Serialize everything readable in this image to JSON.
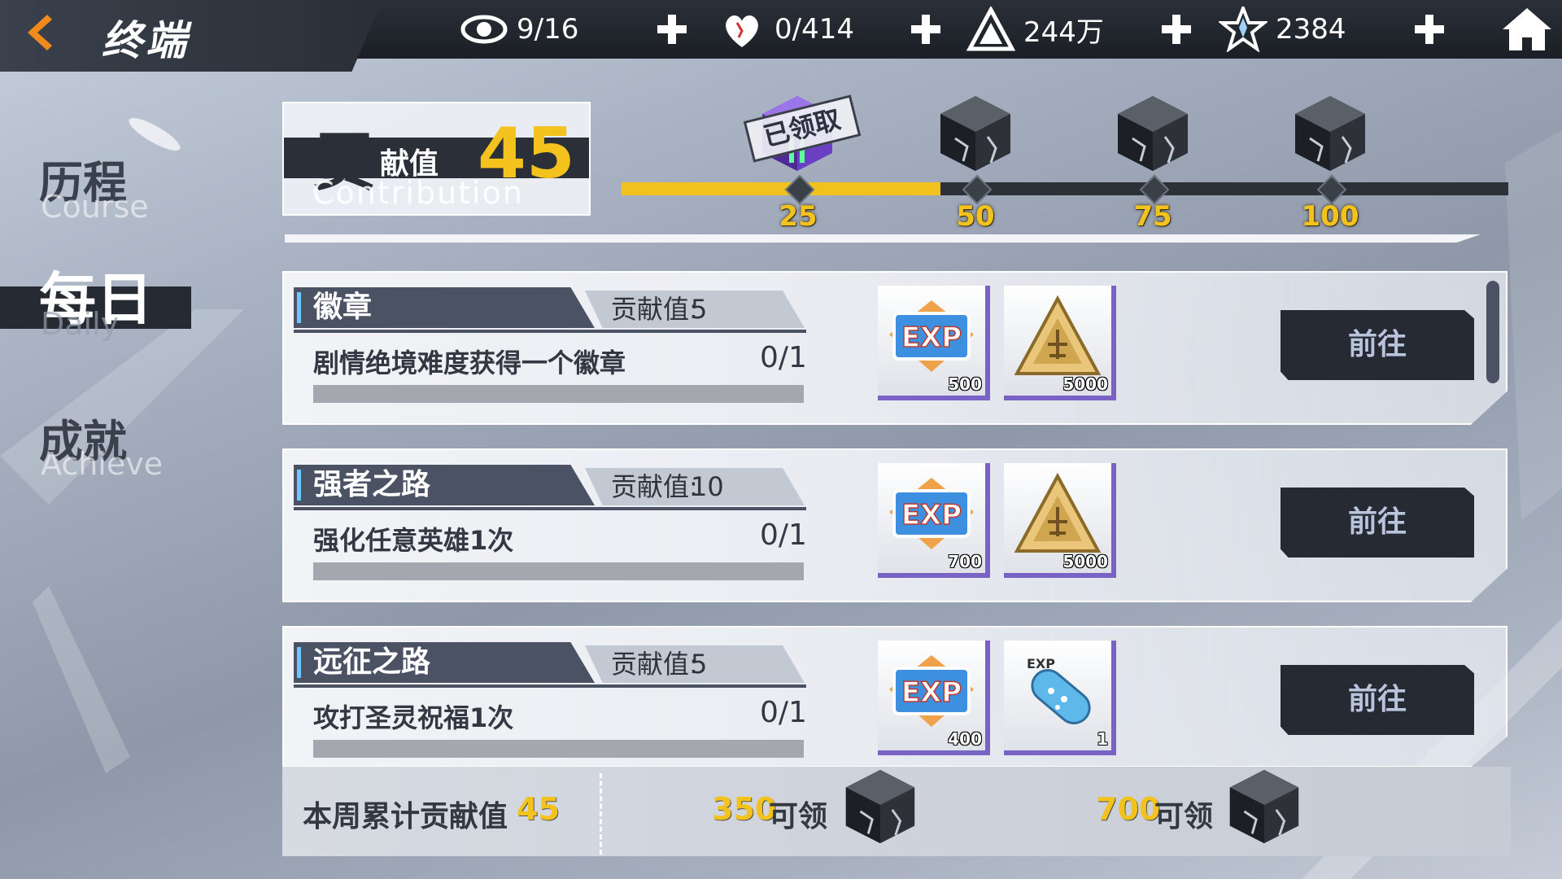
{
  "topbar": {
    "title": "终端",
    "resources": [
      {
        "name": "stamina",
        "icon": "eye-icon",
        "value": "9/16"
      },
      {
        "name": "heart",
        "icon": "heart-icon",
        "value": "0/414"
      },
      {
        "name": "gold",
        "icon": "triangle-coin-icon",
        "value": "244万"
      },
      {
        "name": "crystal",
        "icon": "star-crystal-icon",
        "value": "2384"
      }
    ]
  },
  "sidebar": {
    "items": [
      {
        "cn": "历程",
        "en": "Course",
        "active": false
      },
      {
        "cn": "每日",
        "en": "Daily",
        "active": true
      },
      {
        "cn": "成就",
        "en": "Achieve",
        "active": false
      }
    ]
  },
  "contribution": {
    "big_char": "贡",
    "small_text": "献值",
    "value": "45",
    "en": "Contribution",
    "progress": 0.45,
    "claimed_stamp": "已领取",
    "milestones": [
      "25",
      "50",
      "75",
      "100"
    ]
  },
  "tasks": [
    {
      "name": "徽章",
      "points_label": "贡献值:",
      "points": "5",
      "desc": "剧情绝境难度获得一个徽章",
      "progress": "0/1",
      "rewards": [
        {
          "icon": "exp-icon",
          "count": "500"
        },
        {
          "icon": "gold-coin-icon",
          "count": "5000"
        }
      ],
      "button": "前往"
    },
    {
      "name": "强者之路",
      "points_label": "贡献值:",
      "points": "10",
      "desc": "强化任意英雄1次",
      "progress": "0/1",
      "rewards": [
        {
          "icon": "exp-icon",
          "count": "700"
        },
        {
          "icon": "gold-coin-icon",
          "count": "5000"
        }
      ],
      "button": "前往"
    },
    {
      "name": "远征之路",
      "points_label": "贡献值:",
      "points": "5",
      "desc": "攻打圣灵祝福1次",
      "progress": "0/1",
      "rewards": [
        {
          "icon": "exp-icon",
          "count": "400"
        },
        {
          "icon": "exp-capsule-icon",
          "count": "1"
        }
      ],
      "button": "前往"
    }
  ],
  "weekly": {
    "label": "本周累计贡献值",
    "value": "45",
    "goals": [
      {
        "value": "350",
        "label": "可领"
      },
      {
        "value": "700",
        "label": "可领"
      }
    ]
  },
  "colors": {
    "accent": "#f4c21c",
    "dark": "#262b33",
    "reward_border": "#7a61c4"
  }
}
